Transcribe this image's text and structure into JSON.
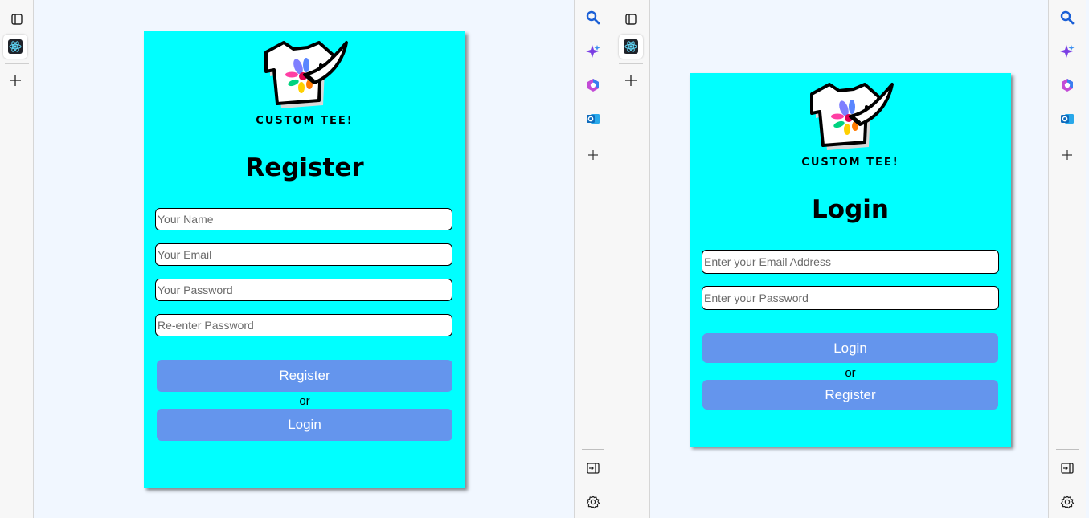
{
  "brand": {
    "name": "CUSTOM TEE!"
  },
  "register_form": {
    "title": "Register",
    "name_placeholder": "Your Name",
    "email_placeholder": "Your Email",
    "password_placeholder": "Your Password",
    "confirm_placeholder": "Re-enter Password",
    "primary_button": "Register",
    "or_text": "or",
    "secondary_button": "Login"
  },
  "login_form": {
    "title": "Login",
    "email_placeholder": "Enter your Email Address",
    "password_placeholder": "Enter your Password",
    "primary_button": "Login",
    "or_text": "or",
    "secondary_button": "Register"
  },
  "sidebar": {
    "icons": [
      "search-icon",
      "copilot-icon",
      "office-icon",
      "outlook-icon",
      "add-icon",
      "split-screen-icon",
      "settings-icon"
    ]
  },
  "colors": {
    "card_background": "#00ffff",
    "button_background": "#6495ed",
    "button_text": "#ffffff",
    "page_background": "#f1f7ff"
  }
}
